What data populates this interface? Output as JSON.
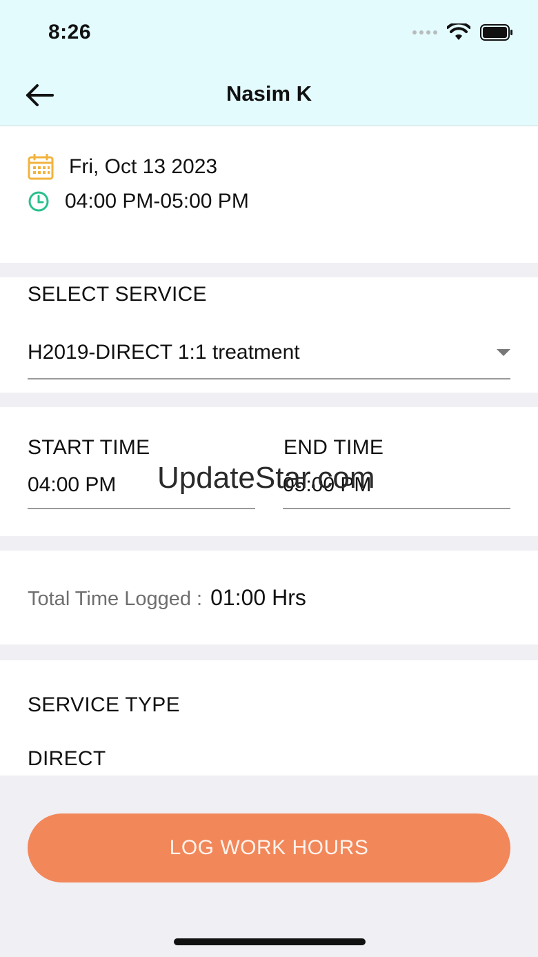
{
  "status_bar": {
    "time": "8:26"
  },
  "nav": {
    "title": "Nasim K",
    "back_icon": "arrow-left-icon"
  },
  "appointment": {
    "date": "Fri, Oct 13 2023",
    "time_range": "04:00 PM-05:00 PM"
  },
  "service": {
    "label": "SELECT SERVICE",
    "selected": "H2019-DIRECT 1:1 treatment"
  },
  "times": {
    "start_label": "START TIME",
    "start_value": "04:00 PM",
    "end_label": "END TIME",
    "end_value": "05:00 PM"
  },
  "total": {
    "label": "Total Time  Logged :",
    "value": "01:00 Hrs"
  },
  "service_type": {
    "label": "SERVICE TYPE",
    "value": "DIRECT"
  },
  "action": {
    "log_label": "LOG WORK HOURS"
  },
  "watermark": "UpdateStar.com",
  "colors": {
    "header_bg": "#e3fbfd",
    "accent": "#f2875a",
    "calendar": "#f2b33d",
    "clock": "#2bbf8e"
  }
}
